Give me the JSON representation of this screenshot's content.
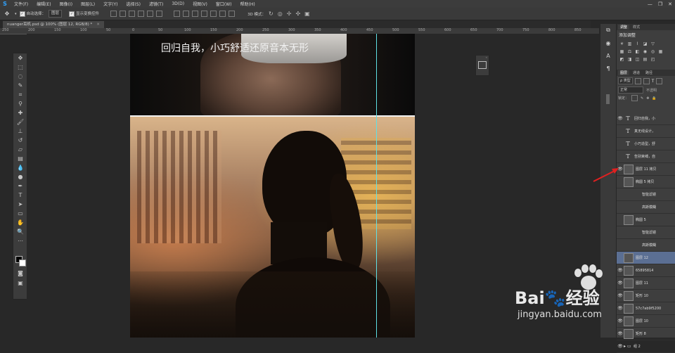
{
  "menubar": {
    "logo": "S",
    "items": [
      "文件(F)",
      "编辑(E)",
      "图像(I)",
      "图层(L)",
      "文字(Y)",
      "选择(S)",
      "滤镜(T)",
      "3D(D)",
      "视图(V)",
      "窗口(W)",
      "帮助(H)"
    ],
    "window_controls": [
      "—",
      "❐",
      "✕"
    ]
  },
  "options": {
    "auto_select_label": "自动选择：",
    "auto_select_value": "图层",
    "show_transform_label": "显示变换控件",
    "mode_3d_label": "3D 模式："
  },
  "document": {
    "tab_title": "nuanger耳机.psd @ 100% (图层 12, RGB/8) *",
    "tab_close": "✕",
    "caption": "回归自我，小巧舒适还原音本无形"
  },
  "ruler": {
    "ticks": [
      "250",
      "200",
      "150",
      "100",
      "50",
      "0",
      "50",
      "100",
      "150",
      "200",
      "250",
      "300",
      "350",
      "400",
      "450",
      "500",
      "550",
      "600",
      "650",
      "700",
      "750",
      "800",
      "850"
    ]
  },
  "panels": {
    "adjust_tabs": [
      "调整",
      "样式"
    ],
    "adjust_title": "添加调整",
    "layer_tabs": [
      "图层",
      "通道",
      "路径"
    ],
    "filter_type": "ρ 类型",
    "blend_mode": "正常",
    "opacity_label": "不透明",
    "lock_label": "锁定："
  },
  "layers": [
    {
      "name": "回归自我，小",
      "kind": "text",
      "eye": "👁",
      "selected": false
    },
    {
      "name": "真无线设计，",
      "kind": "text",
      "eye": "",
      "selected": false
    },
    {
      "name": "小巧造型，舒",
      "kind": "text",
      "eye": "",
      "selected": false
    },
    {
      "name": "告别束缚，自",
      "kind": "text",
      "eye": "",
      "selected": false
    },
    {
      "name": "图层 11 拷贝",
      "kind": "image",
      "eye": "👁",
      "selected": false
    },
    {
      "name": "椭圆 5 拷贝",
      "kind": "image",
      "eye": "",
      "selected": false
    },
    {
      "name": "智能滤镜",
      "kind": "sub",
      "eye": "",
      "selected": false
    },
    {
      "name": "高斯模糊",
      "kind": "sub",
      "eye": "",
      "selected": false
    },
    {
      "name": "椭圆 5",
      "kind": "image",
      "eye": "",
      "selected": false
    },
    {
      "name": "智能滤镜",
      "kind": "sub",
      "eye": "",
      "selected": false
    },
    {
      "name": "高斯模糊",
      "kind": "sub",
      "eye": "",
      "selected": false
    },
    {
      "name": "图层 12",
      "kind": "image",
      "eye": "",
      "selected": true
    },
    {
      "name": "65895814",
      "kind": "image",
      "eye": "👁",
      "selected": false
    },
    {
      "name": "图层 11",
      "kind": "image",
      "eye": "👁",
      "selected": false
    },
    {
      "name": "矩形 10",
      "kind": "image",
      "eye": "👁",
      "selected": false
    },
    {
      "name": "57c7ab9f5200",
      "kind": "image",
      "eye": "👁",
      "selected": false
    },
    {
      "name": "图层 10",
      "kind": "image",
      "eye": "👁",
      "selected": false
    },
    {
      "name": "矩形 8",
      "kind": "image",
      "eye": "👁",
      "selected": false
    },
    {
      "name": "组 2",
      "kind": "group",
      "eye": "👁",
      "selected": false
    }
  ],
  "watermark": {
    "brand": "Bai🐾经验",
    "url": "jingyan.baidu.com"
  },
  "colors": {
    "accent_selected": "#5b6f93",
    "guide": "#5fe0e6",
    "arrow": "#e02020"
  }
}
